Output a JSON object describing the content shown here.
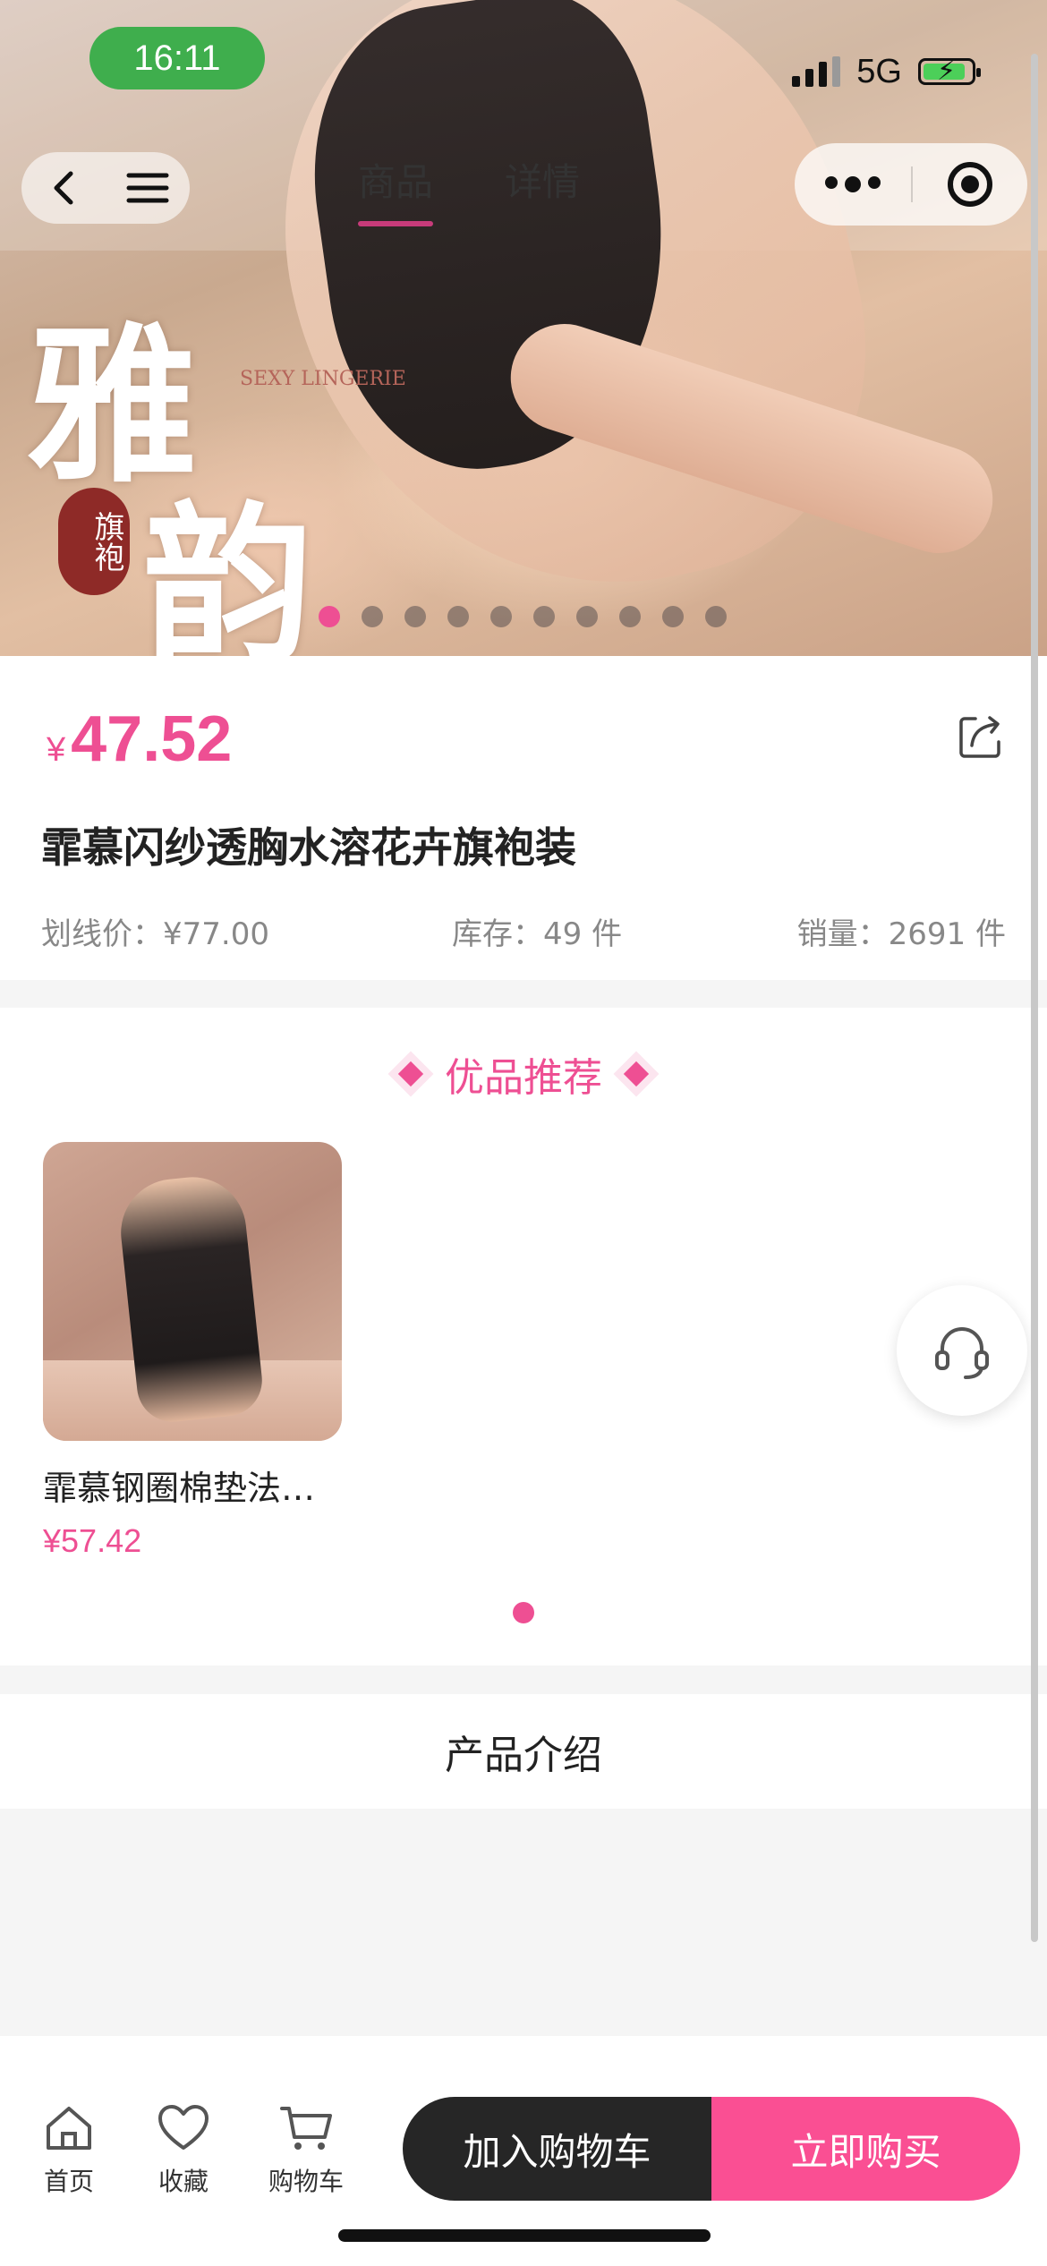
{
  "status_bar": {
    "time": "16:11",
    "network": "5G"
  },
  "nav": {
    "tabs": [
      {
        "label": "商品",
        "active": true
      },
      {
        "label": "详情",
        "active": false
      }
    ]
  },
  "hero": {
    "big_chars": [
      "雅",
      "韵"
    ],
    "seal_text": "旗袍",
    "brand_mark": "SEXY LINGERIE",
    "carousel_total": 10,
    "carousel_active_index": 0
  },
  "product": {
    "currency": "¥",
    "price": "47.52",
    "title": "霏慕闪纱透胸水溶花卉旗袍装",
    "original_price": "划线价：¥77.00",
    "stock": "库存：49 件",
    "sales": "销量：2691 件"
  },
  "recommend": {
    "title": "优品推荐",
    "items": [
      {
        "name": "霏慕钢圈棉垫法…",
        "price": "¥57.42"
      }
    ]
  },
  "intro": {
    "title": "产品介绍"
  },
  "bottom_bar": {
    "home": "首页",
    "favorite": "收藏",
    "cart": "购物车",
    "add_to_cart": "加入购物车",
    "buy_now": "立即购买"
  },
  "colors": {
    "accent": "#ee4f93",
    "buy_button": "#fa4f93",
    "add_button": "#262626",
    "time_pill": "#3fae4d"
  }
}
